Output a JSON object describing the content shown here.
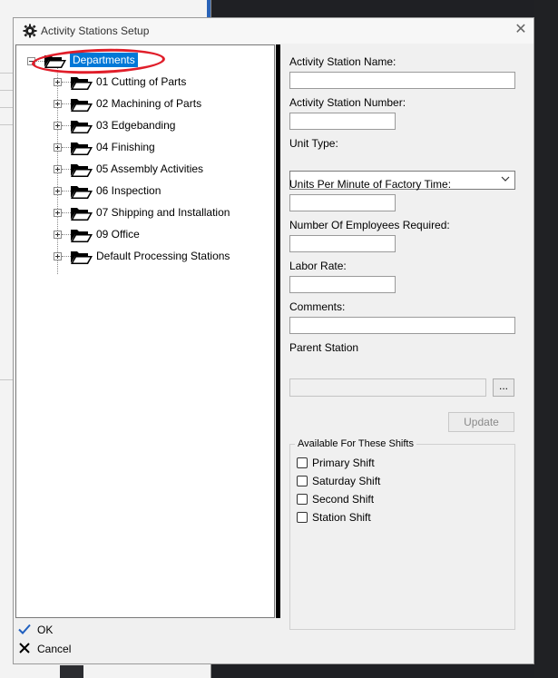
{
  "window": {
    "title": "Activity Stations Setup",
    "close_label": "✕"
  },
  "tree": {
    "root_label": "Departments",
    "items": [
      {
        "label": "01 Cutting of Parts"
      },
      {
        "label": "02 Machining of Parts"
      },
      {
        "label": "03 Edgebanding"
      },
      {
        "label": "04 Finishing"
      },
      {
        "label": "05 Assembly Activities"
      },
      {
        "label": "06 Inspection"
      },
      {
        "label": "07 Shipping and Installation"
      },
      {
        "label": "09 Office"
      },
      {
        "label": "Default Processing Stations"
      }
    ]
  },
  "form": {
    "station_name_label": "Activity Station Name:",
    "station_name_value": "",
    "station_number_label": "Activity Station Number:",
    "station_number_value": "",
    "unit_type_label": "Unit Type:",
    "unit_type_value": "",
    "units_per_minute_label": "Units Per Minute of Factory Time:",
    "units_per_minute_value": "",
    "employees_label": "Number Of Employees Required:",
    "employees_value": "",
    "labor_rate_label": "Labor Rate:",
    "labor_rate_value": "",
    "comments_label": "Comments:",
    "comments_value": "",
    "parent_station_label": "Parent Station",
    "parent_station_value": "",
    "browse_label": "...",
    "update_label": "Update"
  },
  "shifts": {
    "group_title": "Available For These Shifts",
    "items": [
      {
        "label": "Primary Shift",
        "checked": false
      },
      {
        "label": "Saturday Shift",
        "checked": false
      },
      {
        "label": "Second Shift",
        "checked": false
      },
      {
        "label": "Station Shift",
        "checked": false
      }
    ]
  },
  "actions": {
    "ok_label": "OK",
    "cancel_label": "Cancel"
  },
  "colors": {
    "selection": "#0078d7",
    "annotation_ring": "#e01e2a",
    "dialog_bg": "#f0f0f0"
  },
  "icons": {
    "title": "gear-icon",
    "tree_nodes": "folder-open-icon",
    "ok": "checkmark-icon",
    "cancel": "x-icon"
  }
}
